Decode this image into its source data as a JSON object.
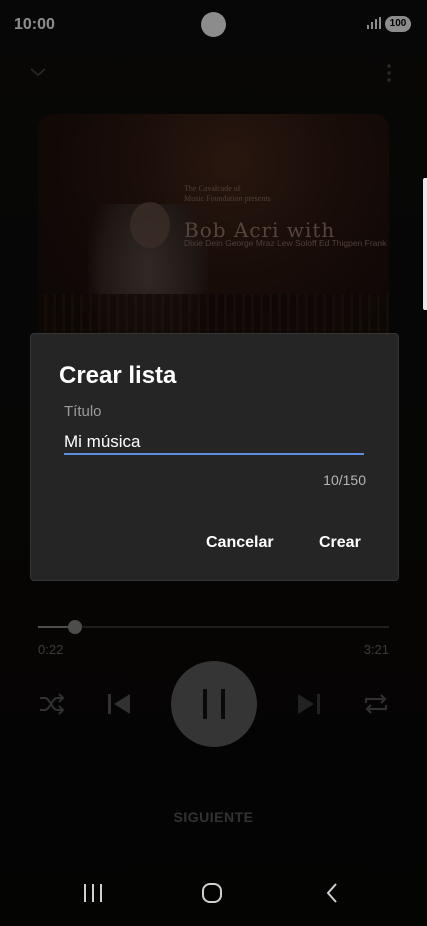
{
  "status_bar": {
    "time": "10:00",
    "battery": "100"
  },
  "album": {
    "line1": "The Cavalcade of",
    "line2": "Music Foundation presents",
    "title": "Bob Acri with",
    "names": "Dixie Dein George Mraz Lew Soloff Ed Thigpen Frank Wess"
  },
  "dialog": {
    "title": "Crear lista",
    "field_label": "Título",
    "field_value": "Mi música",
    "counter": "10/150",
    "cancel_label": "Cancelar",
    "create_label": "Crear"
  },
  "player": {
    "elapsed": "0:22",
    "total": "3:21",
    "progress_fraction": 0.105,
    "next_label": "SIGUIENTE"
  },
  "icons": {
    "collapse": "chevron-down-icon",
    "more": "more-vertical-icon",
    "shuffle": "shuffle-icon",
    "previous": "skip-previous-icon",
    "pause": "pause-icon",
    "next": "skip-next-icon",
    "repeat": "repeat-icon",
    "recents": "recents-icon",
    "home": "home-icon",
    "back": "back-icon"
  },
  "colors": {
    "accent": "#5b8de0",
    "dialog_bg": "#252525"
  }
}
